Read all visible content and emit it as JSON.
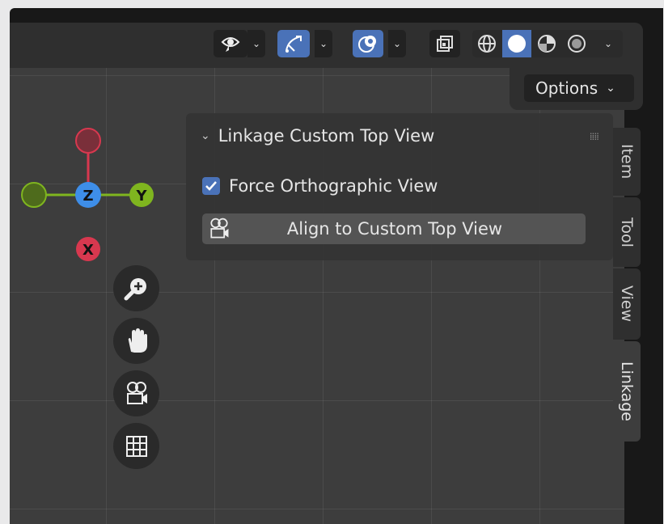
{
  "header": {
    "options_label": "Options"
  },
  "gizmo": {
    "z_label": "Z",
    "y_label": "Y",
    "x_label": "X",
    "colors": {
      "x": "#d8384f",
      "y": "#7fb51f",
      "z": "#3e8ee8"
    }
  },
  "panel": {
    "title": "Linkage Custom Top View",
    "force_ortho_label": "Force Orthographic View",
    "force_ortho_checked": true,
    "align_button_label": "Align to Custom Top View"
  },
  "tabs": {
    "item": "Item",
    "tool": "Tool",
    "view": "View",
    "linkage": "Linkage",
    "active": "Linkage"
  },
  "icons": {
    "visibility": "eye-icon",
    "gizmos": "gizmo-icon",
    "overlays": "overlay-icon",
    "xray": "xray-icon",
    "wireframe": "wireframe-shading-icon",
    "solid": "solid-shading-icon",
    "material": "material-shading-icon",
    "rendered": "rendered-shading-icon",
    "zoom": "zoom-icon",
    "pan": "hand-icon",
    "camera": "camera-icon",
    "ortho_grid": "grid-icon"
  },
  "accent_color": "#4a72b8"
}
